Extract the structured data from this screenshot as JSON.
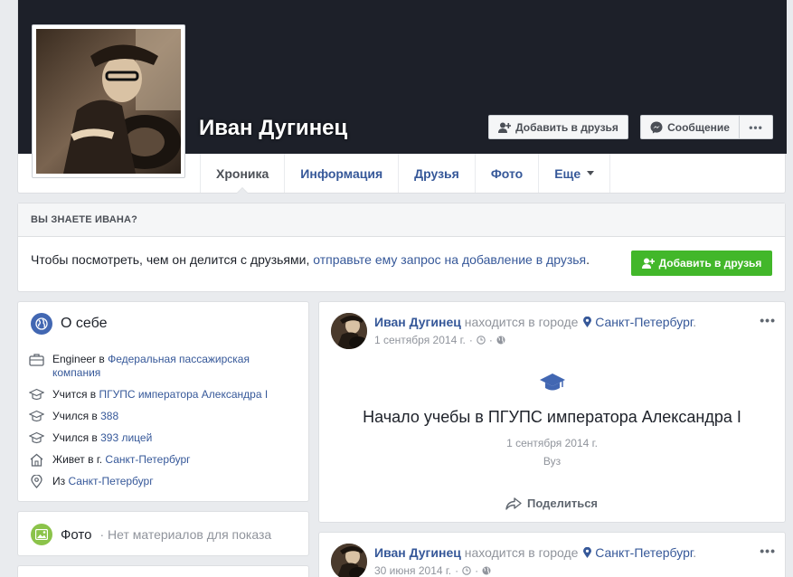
{
  "profile": {
    "name": "Иван Дугинец",
    "add_friend_label": "Добавить в друзья",
    "message_label": "Сообщение",
    "more_label": "•••"
  },
  "tabs": [
    {
      "label": "Хроника"
    },
    {
      "label": "Информация"
    },
    {
      "label": "Друзья"
    },
    {
      "label": "Фото"
    },
    {
      "label": "Еще"
    }
  ],
  "know_box": {
    "heading": "ВЫ ЗНАЕТЕ ИВАНА?",
    "text": "Чтобы посмотреть, чем он делится с друзьями, ",
    "link": "отправьте ему запрос на добавление в друзья",
    "text_end": ".",
    "button_label": "Добавить в друзья"
  },
  "about": {
    "title": "О себе",
    "items": [
      {
        "icon": "briefcase-icon",
        "prefix": "Engineer в ",
        "link": "Федеральная пассажирская компания"
      },
      {
        "icon": "graduation-cap-icon",
        "prefix": "Учится в ",
        "link": "ПГУПС императора Александра I"
      },
      {
        "icon": "graduation-cap-icon",
        "prefix": "Учился в ",
        "link": "388"
      },
      {
        "icon": "graduation-cap-icon",
        "prefix": "Учился в ",
        "link": "393 лицей"
      },
      {
        "icon": "home-icon",
        "prefix": "Живет в г. ",
        "link": "Санкт-Петербург"
      },
      {
        "icon": "location-pin-icon",
        "prefix": "Из ",
        "link": "Санкт-Петербург"
      }
    ]
  },
  "photos": {
    "title": "Фото",
    "empty": "· Нет материалов для показа"
  },
  "posts": [
    {
      "author": "Иван Дугинец",
      "action": "находится в городе",
      "location": "Санкт-Петербург",
      "date": "1 сентября 2014 г.",
      "life_event_title": "Начало учебы в ПГУПС императора Александра I",
      "life_event_date": "1 сентября 2014 г.",
      "life_event_sub": "Вуз",
      "share_label": "Поделиться",
      "more_label": "•••"
    },
    {
      "author": "Иван Дугинец",
      "action": "находится в городе",
      "location": "Санкт-Петербург",
      "date": "30 июня 2014 г.",
      "more_label": "•••"
    }
  ],
  "colors": {
    "cover": "#1d2029",
    "link": "#365899",
    "green": "#42b72a"
  }
}
